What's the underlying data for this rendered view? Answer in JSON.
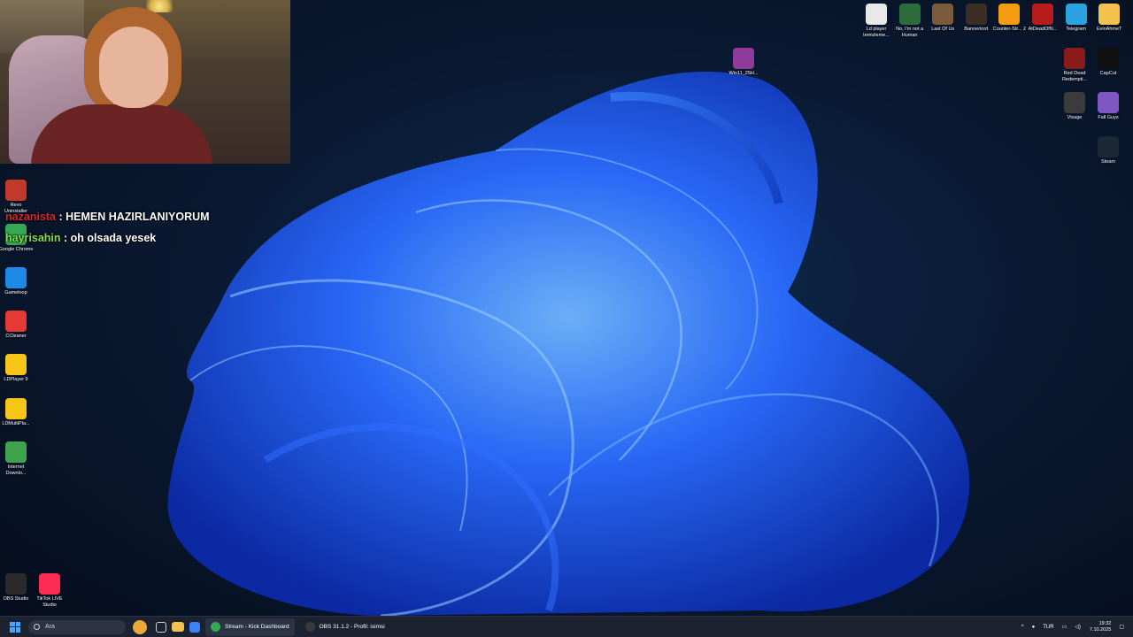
{
  "chat": {
    "lines": [
      {
        "user": "nazanista",
        "sep": " : ",
        "msg": "HEMEN HAZIRLANIYORUM"
      },
      {
        "user": "hayrisahin",
        "sep": " : ",
        "msg": "oh olsada yesek"
      }
    ]
  },
  "desktop_icons_left": [
    {
      "label": "Revo Uninstaller",
      "icon": "revo-icon",
      "color": "#c0392b"
    },
    {
      "label": "Google Chrome",
      "icon": "chrome-icon",
      "color": "#34a853"
    },
    {
      "label": "Gameloop",
      "icon": "gameloop-icon",
      "color": "#1e88e5"
    },
    {
      "label": "CCleaner",
      "icon": "ccleaner-icon",
      "color": "#e53935"
    },
    {
      "label": "LDPlayer 9",
      "icon": "ldplayer-icon",
      "color": "#f5c518"
    },
    {
      "label": "LDMultiPla...",
      "icon": "ldmultiplayer-icon",
      "color": "#f5c518"
    },
    {
      "label": "Internet Downlo...",
      "icon": "idm-icon",
      "color": "#3fa34d"
    },
    {
      "label": "OBS Studio",
      "icon": "obs-icon",
      "color": "#2b2b2b"
    },
    {
      "label": "TikTok LIVE Studio",
      "icon": "tiktok-icon",
      "color": "#fe2c55"
    }
  ],
  "desktop_icons_top": [
    {
      "label": "Ld player temizleme...",
      "icon": "document-icon",
      "color": "#e8e8e8"
    },
    {
      "label": "No, I'm not a Human",
      "icon": "game-icon",
      "color": "#2e6b3a"
    },
    {
      "label": "Last Of Us",
      "icon": "game-icon",
      "color": "#7a5a3a"
    },
    {
      "label": "Bannerlord",
      "icon": "game-icon",
      "color": "#3a2e22"
    },
    {
      "label": "Counter-Str... 2",
      "icon": "cs2-icon",
      "color": "#f39c12"
    },
    {
      "label": "AtDeadOfN...",
      "icon": "game-icon",
      "color": "#b71c1c"
    },
    {
      "label": "Telegram",
      "icon": "telegram-icon",
      "color": "#2aa3e0"
    },
    {
      "label": "EvinAhmeT",
      "icon": "folder-icon",
      "color": "#f2c14e"
    }
  ],
  "desktop_icons_right": [
    {
      "label": "Red Dead Redempti...",
      "icon": "rdr-icon",
      "color": "#8b1a1a"
    },
    {
      "label": "CapCut",
      "icon": "capcut-icon",
      "color": "#111111"
    },
    {
      "label": "Visage",
      "icon": "visage-icon",
      "color": "#3b3b3b"
    },
    {
      "label": "Fall Guys",
      "icon": "fallguys-icon",
      "color": "#7e57c2"
    },
    {
      "label": "Steam",
      "icon": "steam-icon",
      "color": "#1b2838"
    }
  ],
  "desktop_icon_center": {
    "label": "Win11_25H...",
    "icon": "winrar-icon",
    "color": "#8e3b9b"
  },
  "taskbar": {
    "search_placeholder": "Ara",
    "apps": [
      {
        "label": "Stream - Kick Dashboard",
        "icon": "chrome-icon",
        "color": "#34a853",
        "active": true
      },
      {
        "label": "OBS 31.1.2 - Profil: isimsi",
        "icon": "obs-icon",
        "color": "#3a3a3a",
        "active": false
      }
    ],
    "tray": {
      "language": "TUR",
      "time": "19:32",
      "date": "7.10.2025"
    }
  },
  "colors": {
    "wallpaper_bg": "#0a1a33",
    "bloom": "#1f5fff",
    "taskbar": "#1c2230"
  }
}
